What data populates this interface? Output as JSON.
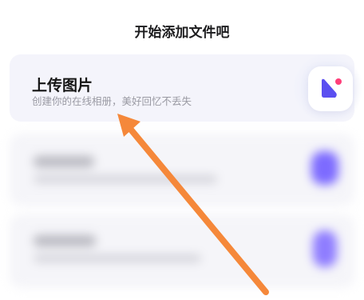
{
  "header": {
    "title": "开始添加文件吧"
  },
  "upload_card": {
    "title": "上传图片",
    "subtitle": "创建你的在线相册，美好回忆不丢失",
    "icon": "image-icon",
    "icon_colors": {
      "primary": "#5b4ff0",
      "accent": "#ff3e7a"
    }
  },
  "colors": {
    "blurred_accent": "#7d6bff",
    "arrow": "#f5883a"
  }
}
